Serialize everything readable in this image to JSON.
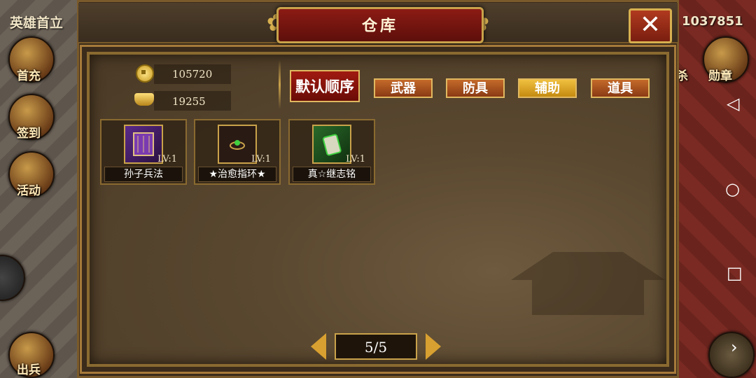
{
  "background": {
    "top_left_text": "英雄首立",
    "top_right_text": "1037851",
    "side_buttons": [
      {
        "label": "首充"
      },
      {
        "label": "签到"
      },
      {
        "label": "活动"
      },
      {
        "label": "出兵"
      }
    ],
    "right_labels": [
      "杀",
      "勋章"
    ]
  },
  "dialog": {
    "title": "仓库",
    "close_label": "✕",
    "currency": {
      "coins": "105720",
      "ingots": "19255"
    },
    "sort_label": "默认顺序",
    "tabs": [
      {
        "label": "武器",
        "active": false
      },
      {
        "label": "防具",
        "active": false
      },
      {
        "label": "辅助",
        "active": true
      },
      {
        "label": "道具",
        "active": false
      }
    ],
    "items": [
      {
        "name": "孙子兵法",
        "level": "LV:1",
        "icon": "book-icon"
      },
      {
        "name": "★治愈指环★",
        "level": "LV:1",
        "icon": "ring-icon"
      },
      {
        "name": "真☆继志铭",
        "level": "LV:1",
        "icon": "tablet-icon"
      }
    ],
    "pager": {
      "text": "5/5"
    }
  },
  "colors": {
    "accent_gold": "#c9a24a",
    "title_red": "#8c1b14",
    "active_tab": "#f0c040"
  }
}
